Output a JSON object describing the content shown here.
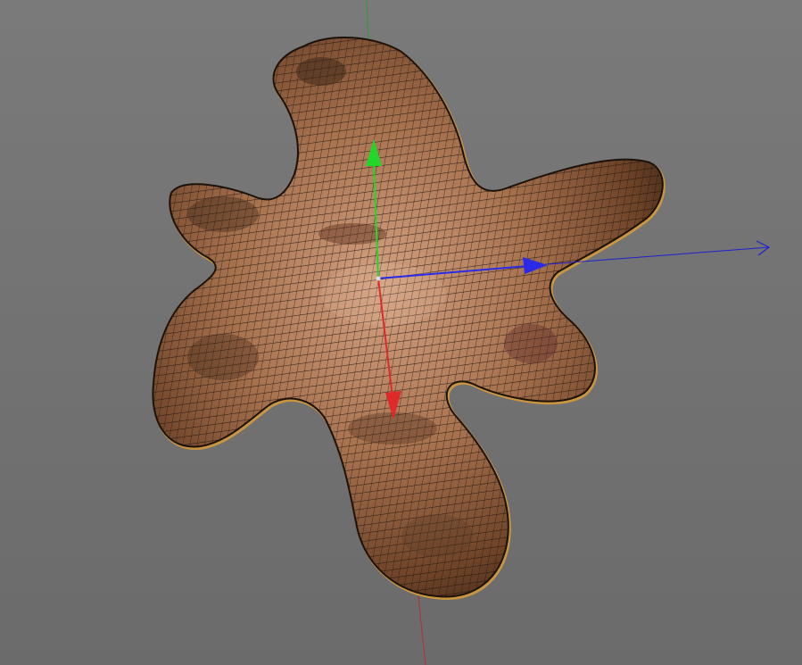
{
  "viewport": {
    "background": "#757575"
  },
  "model": {
    "name": "",
    "display_mode": "wireframe-on-shaded",
    "texture": "wood-bark",
    "outline_color": "#c9953f",
    "wire_color": "#1a120c",
    "base_color": "#9c6a45"
  },
  "gizmo": {
    "axes": [
      {
        "name": "x",
        "color": "#e02a2a"
      },
      {
        "name": "y",
        "color": "#22d62a"
      },
      {
        "name": "z",
        "color": "#2a2ae8"
      }
    ]
  },
  "axis_lines": [
    {
      "name": "y",
      "color": "#2ea02e"
    },
    {
      "name": "x",
      "color": "#b03030"
    },
    {
      "name": "z",
      "color": "#2020d0"
    }
  ]
}
